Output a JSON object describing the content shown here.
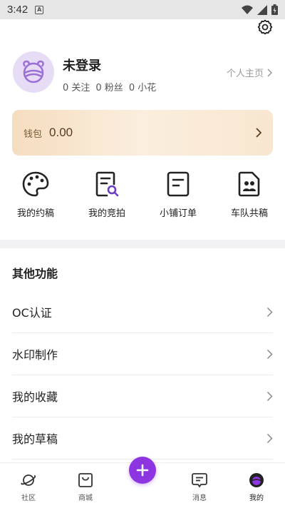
{
  "status_bar": {
    "time": "3:42",
    "notification_badge": "A"
  },
  "profile": {
    "username": "未登录",
    "following": "0 关注",
    "fans": "0 粉丝",
    "flowers": "0 小花",
    "homepage_link": "个人主页"
  },
  "wallet": {
    "label": "钱包",
    "amount": "0.00"
  },
  "quick_actions": [
    {
      "label": "我的约稿",
      "icon": "palette-icon"
    },
    {
      "label": "我的竞拍",
      "icon": "auction-document-icon"
    },
    {
      "label": "小铺订单",
      "icon": "order-document-icon"
    },
    {
      "label": "车队共稿",
      "icon": "team-document-icon"
    }
  ],
  "other_functions": {
    "title": "其他功能",
    "items": [
      "OC认证",
      "水印制作",
      "我的收藏",
      "我的草稿"
    ]
  },
  "tab_bar": {
    "tabs": [
      {
        "label": "社区",
        "icon": "planet-icon"
      },
      {
        "label": "商城",
        "icon": "shopping-bag-icon"
      },
      {
        "label": "",
        "icon": "plus-icon"
      },
      {
        "label": "消息",
        "icon": "chat-icon"
      },
      {
        "label": "我的",
        "icon": "profile-planet-icon",
        "active": true
      }
    ]
  },
  "colors": {
    "accent": "#8c35e0",
    "wallet_gradient_start": "#f5ddbf",
    "wallet_text": "#7a5a3a",
    "avatar_bg": "#e6dcf5"
  }
}
